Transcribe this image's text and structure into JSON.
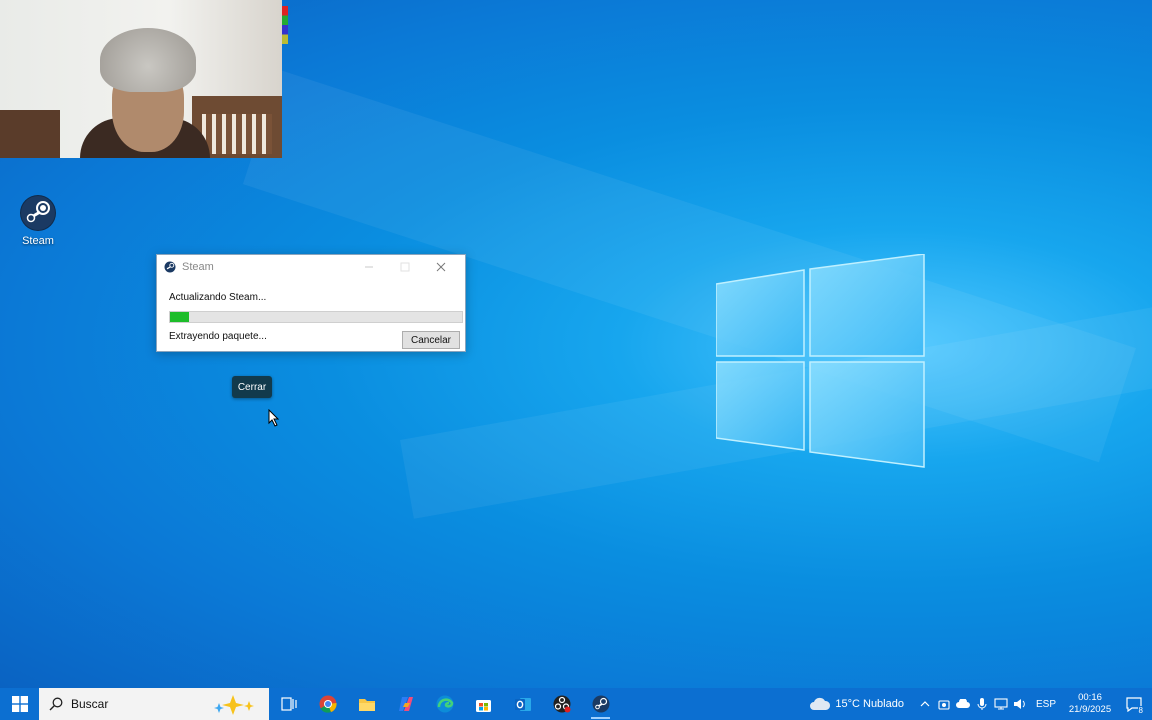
{
  "desktop": {
    "icons": [
      {
        "label": "Steam"
      }
    ]
  },
  "window": {
    "title": "Steam",
    "status_text": "Actualizando Steam...",
    "sub_status_text": "Extrayendo paquete...",
    "progress_fraction": 0.066,
    "cancel_label": "Cancelar",
    "accent_color": "#1dbd2a"
  },
  "tooltip": {
    "label": "Cerrar"
  },
  "taskbar": {
    "search_placeholder": "Buscar",
    "apps": [
      {
        "icon": "task-view-icon"
      },
      {
        "icon": "chrome-icon"
      },
      {
        "icon": "file-explorer-icon"
      },
      {
        "icon": "copilot-icon"
      },
      {
        "icon": "edge-icon"
      },
      {
        "icon": "store-icon"
      },
      {
        "icon": "outlook-icon"
      },
      {
        "icon": "obs-icon"
      },
      {
        "icon": "steam-icon"
      }
    ],
    "weather": "15°C  Nublado",
    "language": "ESP",
    "time": "00:16",
    "date": "21/9/2025",
    "notification_count": "8"
  }
}
